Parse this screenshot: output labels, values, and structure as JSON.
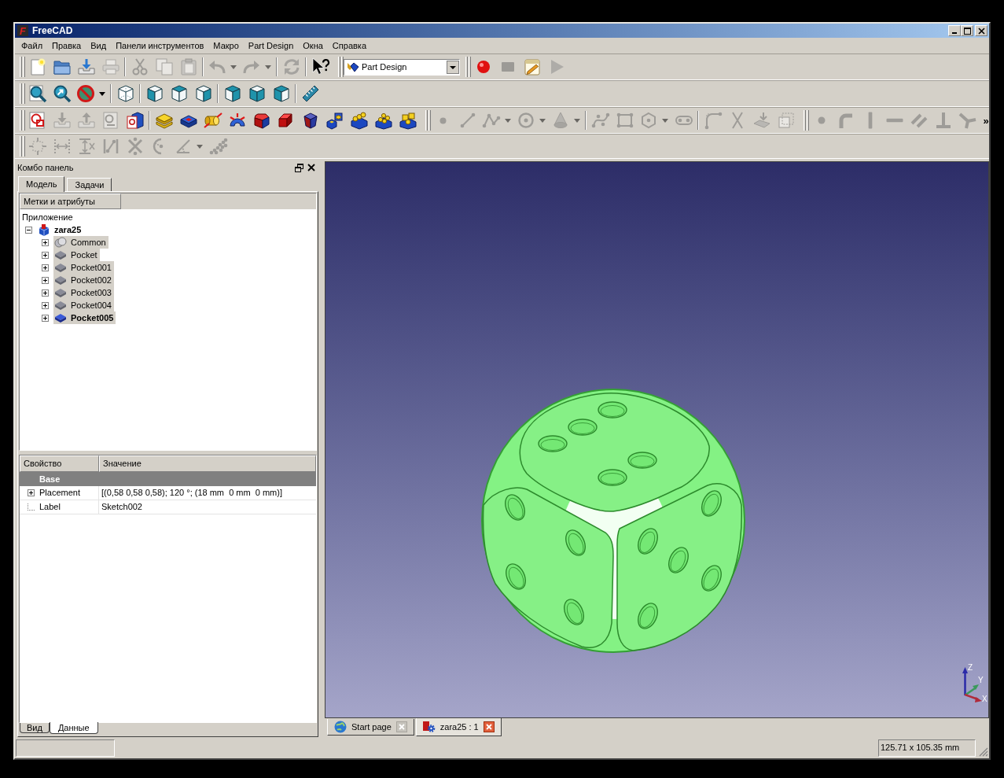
{
  "window": {
    "logo": "F",
    "title": "FreeCAD"
  },
  "menu": [
    "Файл",
    "Правка",
    "Вид",
    "Панели инструментов",
    "Макро",
    "Part Design",
    "Окна",
    "Справка"
  ],
  "toolbar_rows": [
    {
      "toolbars": [
        {
          "items": [
            {
              "kind": "new",
              "disabled": false,
              "menu": false
            },
            {
              "kind": "open",
              "disabled": false,
              "menu": false
            },
            {
              "kind": "save",
              "disabled": false,
              "menu": false
            },
            {
              "kind": "print",
              "disabled": true,
              "menu": false
            },
            {
              "kind": "separator"
            },
            {
              "kind": "cut",
              "disabled": true,
              "menu": false
            },
            {
              "kind": "copy",
              "disabled": true,
              "menu": false
            },
            {
              "kind": "paste",
              "disabled": true,
              "menu": false
            },
            {
              "kind": "separator"
            },
            {
              "kind": "undo",
              "disabled": true,
              "menu": true
            },
            {
              "kind": "redo",
              "disabled": true,
              "menu": true
            },
            {
              "kind": "separator"
            },
            {
              "kind": "refresh",
              "disabled": true,
              "menu": false
            },
            {
              "kind": "separator"
            },
            {
              "kind": "whatsthis",
              "disabled": false,
              "menu": false
            }
          ]
        },
        {
          "items": [
            {
              "kind": "combo",
              "value": "Part Design"
            }
          ]
        },
        {
          "items": [
            {
              "kind": "record",
              "disabled": false,
              "menu": false
            },
            {
              "kind": "stop",
              "disabled": true,
              "menu": false
            },
            {
              "kind": "macro",
              "disabled": false,
              "menu": false
            },
            {
              "kind": "run",
              "disabled": true,
              "menu": false
            }
          ]
        }
      ]
    },
    {
      "toolbars": [
        {
          "items": [
            {
              "kind": "fitall",
              "disabled": false,
              "menu": false
            },
            {
              "kind": "fitsel",
              "disabled": false,
              "menu": false
            },
            {
              "kind": "drawstyle",
              "disabled": false,
              "menu": true
            },
            {
              "kind": "separator"
            },
            {
              "kind": "iso",
              "disabled": false,
              "menu": false
            },
            {
              "kind": "separator"
            },
            {
              "kind": "front",
              "disabled": false,
              "menu": false
            },
            {
              "kind": "top",
              "disabled": false,
              "menu": false
            },
            {
              "kind": "right",
              "disabled": false,
              "menu": false
            },
            {
              "kind": "separator"
            },
            {
              "kind": "rear",
              "disabled": false,
              "menu": false
            },
            {
              "kind": "bottom",
              "disabled": false,
              "menu": false
            },
            {
              "kind": "left",
              "disabled": false,
              "menu": false
            },
            {
              "kind": "separator"
            },
            {
              "kind": "measure",
              "disabled": false,
              "menu": false
            }
          ]
        }
      ]
    },
    {
      "toolbars": [
        {
          "items": [
            {
              "kind": "sketch",
              "disabled": false,
              "menu": false
            },
            {
              "kind": "leavesketch",
              "disabled": true,
              "menu": false
            },
            {
              "kind": "mapsketch",
              "disabled": true,
              "menu": false
            },
            {
              "kind": "viewsketch",
              "disabled": true,
              "menu": false
            },
            {
              "kind": "validate",
              "disabled": false,
              "menu": false
            },
            {
              "kind": "separator"
            },
            {
              "kind": "pad",
              "disabled": false,
              "menu": false
            },
            {
              "kind": "pocket",
              "disabled": false,
              "menu": false
            },
            {
              "kind": "revolution",
              "disabled": false,
              "menu": false
            },
            {
              "kind": "groove",
              "disabled": false,
              "menu": false
            },
            {
              "kind": "fillet",
              "disabled": false,
              "menu": false
            },
            {
              "kind": "chamfer",
              "disabled": false,
              "menu": false
            },
            {
              "kind": "draft",
              "disabled": false,
              "menu": false
            },
            {
              "kind": "mirrored",
              "disabled": false,
              "menu": false
            },
            {
              "kind": "linear",
              "disabled": false,
              "menu": false
            },
            {
              "kind": "polar",
              "disabled": false,
              "menu": false
            },
            {
              "kind": "multi",
              "disabled": false,
              "menu": false
            }
          ]
        },
        {
          "items": [
            {
              "kind": "point",
              "disabled": true,
              "menu": false
            },
            {
              "kind": "line",
              "disabled": true,
              "menu": false
            },
            {
              "kind": "polyline",
              "disabled": true,
              "menu": true
            },
            {
              "kind": "circle",
              "disabled": true,
              "menu": true
            },
            {
              "kind": "conic",
              "disabled": true,
              "menu": true
            },
            {
              "kind": "separator"
            },
            {
              "kind": "bspline",
              "disabled": true,
              "menu": false
            },
            {
              "kind": "rect",
              "disabled": true,
              "menu": false
            },
            {
              "kind": "polygon",
              "disabled": true,
              "menu": true
            },
            {
              "kind": "slot",
              "disabled": true,
              "menu": false
            },
            {
              "kind": "separator"
            },
            {
              "kind": "sketchfillet",
              "disabled": true,
              "menu": false
            },
            {
              "kind": "trim",
              "disabled": true,
              "menu": false
            },
            {
              "kind": "external",
              "disabled": true,
              "menu": false
            },
            {
              "kind": "construction",
              "disabled": true,
              "menu": false
            }
          ]
        },
        {
          "items": [
            {
              "kind": "coincident",
              "disabled": true,
              "menu": false
            },
            {
              "kind": "pointonobject",
              "disabled": true,
              "menu": false
            },
            {
              "kind": "vertical",
              "disabled": true,
              "menu": false
            },
            {
              "kind": "horizontal",
              "disabled": true,
              "menu": false
            },
            {
              "kind": "parallel",
              "disabled": true,
              "menu": false
            },
            {
              "kind": "perpendicular",
              "disabled": true,
              "menu": false
            },
            {
              "kind": "tangent",
              "disabled": true,
              "menu": false
            },
            {
              "kind": "more",
              "text": "»"
            }
          ]
        }
      ]
    },
    {
      "toolbars": [
        {
          "items": [
            {
              "kind": "lock",
              "disabled": true,
              "menu": false
            },
            {
              "kind": "distx",
              "disabled": true,
              "menu": false
            },
            {
              "kind": "disty",
              "disabled": true,
              "menu": false
            },
            {
              "kind": "distance",
              "disabled": true,
              "menu": false
            },
            {
              "kind": "symmetric",
              "disabled": true,
              "menu": false
            },
            {
              "kind": "radius",
              "disabled": true,
              "menu": false
            },
            {
              "kind": "angle",
              "disabled": true,
              "menu": true
            },
            {
              "kind": "snell",
              "disabled": true,
              "menu": false
            }
          ]
        }
      ]
    }
  ],
  "combo_panel": {
    "title": "Комбо панель",
    "tabs": [
      {
        "label": "Модель",
        "selected": true
      },
      {
        "label": "Задачи",
        "selected": false
      }
    ],
    "tree": {
      "header": "Метки и атрибуты",
      "root_label": "Приложение",
      "items": [
        {
          "label": "zara25",
          "kind": "document",
          "expanded": true,
          "selected": false,
          "active": true,
          "children": [
            {
              "label": "Common",
              "kind": "boolean",
              "expanded": false,
              "selected": true,
              "active": false,
              "visible": false
            },
            {
              "label": "Pocket",
              "kind": "feature",
              "expanded": false,
              "selected": true,
              "active": false,
              "visible": false
            },
            {
              "label": "Pocket001",
              "kind": "feature",
              "expanded": false,
              "selected": true,
              "active": false,
              "visible": false
            },
            {
              "label": "Pocket002",
              "kind": "feature",
              "expanded": false,
              "selected": true,
              "active": false,
              "visible": false
            },
            {
              "label": "Pocket003",
              "kind": "feature",
              "expanded": false,
              "selected": true,
              "active": false,
              "visible": false
            },
            {
              "label": "Pocket004",
              "kind": "feature",
              "expanded": false,
              "selected": true,
              "active": false,
              "visible": false
            },
            {
              "label": "Pocket005",
              "kind": "feature",
              "expanded": false,
              "selected": true,
              "active": true,
              "visible": true
            }
          ]
        }
      ]
    },
    "properties": {
      "columns": [
        "Свойство",
        "Значение"
      ],
      "groups": [
        {
          "name": "Base",
          "rows": [
            {
              "name": "Placement",
              "value": "[(0,58 0,58 0,58); 120 °; (18 mm  0 mm  0 mm)]",
              "expanded": false
            },
            {
              "name": "Label",
              "value": "Sketch002"
            }
          ]
        }
      ]
    },
    "view_tabs": [
      {
        "label": "Вид",
        "selected": false
      },
      {
        "label": "Данные",
        "selected": true
      }
    ]
  },
  "view_3d": {
    "axes": [
      {
        "label": "Z"
      },
      {
        "label": "Y"
      },
      {
        "label": "X"
      }
    ]
  },
  "document_tabs": [
    {
      "label": "Start page",
      "kind": "web",
      "selected": false
    },
    {
      "label": "zara25 : 1",
      "kind": "document",
      "selected": true
    }
  ],
  "status_bar": {
    "dimensions": "125.71 x 105.35 mm"
  }
}
